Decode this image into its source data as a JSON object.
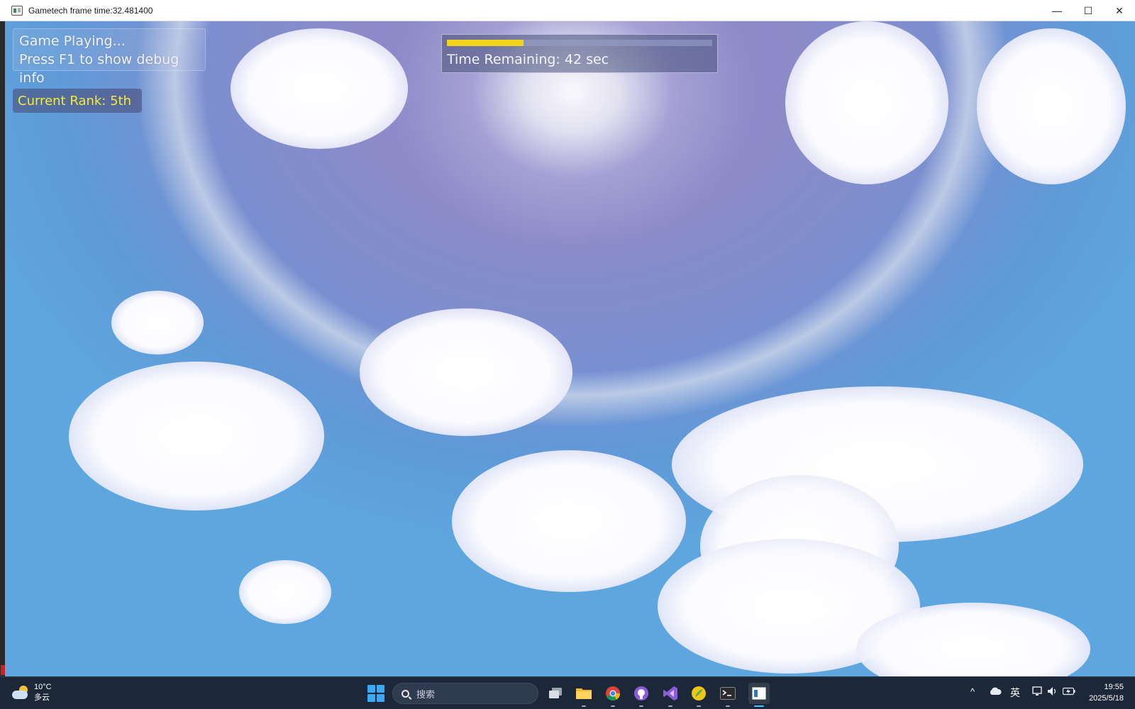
{
  "window": {
    "title": "Gametech frame time:32.481400",
    "controls": {
      "minimize": "—",
      "maximize": "☐",
      "close": "✕"
    }
  },
  "hud": {
    "status_line1": "Game Playing...",
    "status_line2": "Press F1 to show debug info",
    "rank": "Current Rank: 5th",
    "timer_label": "Time Remaining: 42 sec",
    "timer_progress_fraction": 0.29,
    "colors": {
      "rank_text": "#f6ea3a",
      "progress_fill": "#f3d41c"
    }
  },
  "taskbar": {
    "weather": {
      "temperature": "10°C",
      "condition": "多云",
      "icon": "partly-cloudy-icon"
    },
    "search_placeholder": "搜索",
    "apps": [
      {
        "name": "task-view-icon"
      },
      {
        "name": "file-explorer-icon"
      },
      {
        "name": "chrome-icon"
      },
      {
        "name": "github-desktop-icon"
      },
      {
        "name": "visual-studio-icon"
      },
      {
        "name": "app-icon"
      },
      {
        "name": "terminal-icon"
      },
      {
        "name": "game-window-icon",
        "active": true
      }
    ],
    "tray": {
      "overflow": "^",
      "ime": "英"
    },
    "clock": {
      "time": "19:55",
      "date": "2025/5/18"
    }
  }
}
